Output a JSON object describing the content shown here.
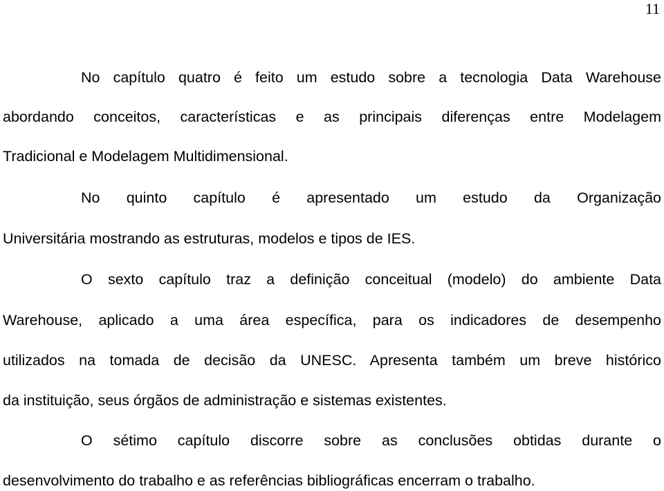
{
  "page": {
    "number": "11"
  },
  "paragraphs": [
    {
      "lines": [
        "No capítulo quatro é feito um estudo sobre a tecnologia Data Warehouse",
        "abordando conceitos, características e as principais diferenças entre Modelagem",
        "Tradicional e Modelagem Multidimensional."
      ]
    },
    {
      "lines": [
        "No quinto capítulo é apresentado um estudo da Organização",
        "Universitária mostrando as estruturas, modelos e tipos de IES."
      ]
    },
    {
      "lines": [
        "O sexto capítulo traz a definição conceitual (modelo) do ambiente Data",
        "Warehouse, aplicado a uma área específica, para os indicadores de desempenho",
        "utilizados na tomada de decisão da UNESC. Apresenta também um breve histórico",
        "da instituição, seus órgãos de administração e sistemas existentes."
      ]
    },
    {
      "lines": [
        "O sétimo capítulo discorre sobre as conclusões obtidas durante o",
        "desenvolvimento do trabalho e as referências bibliográficas encerram o trabalho."
      ]
    }
  ]
}
